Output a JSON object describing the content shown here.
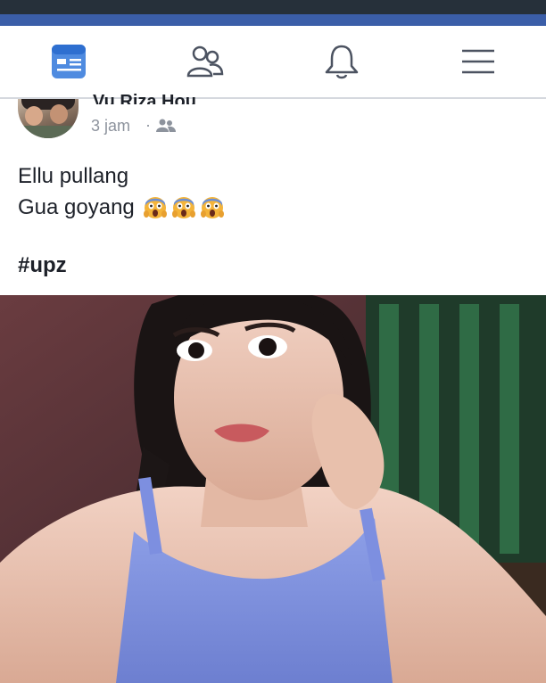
{
  "colors": {
    "status_bar": "#26303a",
    "app_bar": "#3b5ea8",
    "nav_active": "#4f8be0",
    "nav_inactive": "#4c5361",
    "text_primary": "#1d2129",
    "text_secondary": "#8d939d"
  },
  "nav": {
    "tabs": [
      {
        "icon": "news-feed-icon",
        "active": true
      },
      {
        "icon": "friends-icon",
        "active": false
      },
      {
        "icon": "notifications-bell-icon",
        "active": false
      },
      {
        "icon": "menu-hamburger-icon",
        "active": false
      }
    ]
  },
  "post": {
    "author": "Vu Riza Hou",
    "time": "3 jam",
    "separator": "·",
    "audience_icon": "friends-audience-icon",
    "lines": [
      "Ellu pullang",
      "Gua goyang"
    ],
    "emojis": [
      "scream-emoji",
      "scream-emoji",
      "scream-emoji"
    ],
    "hashtag": "#upz",
    "photo": "selfie-photo"
  }
}
